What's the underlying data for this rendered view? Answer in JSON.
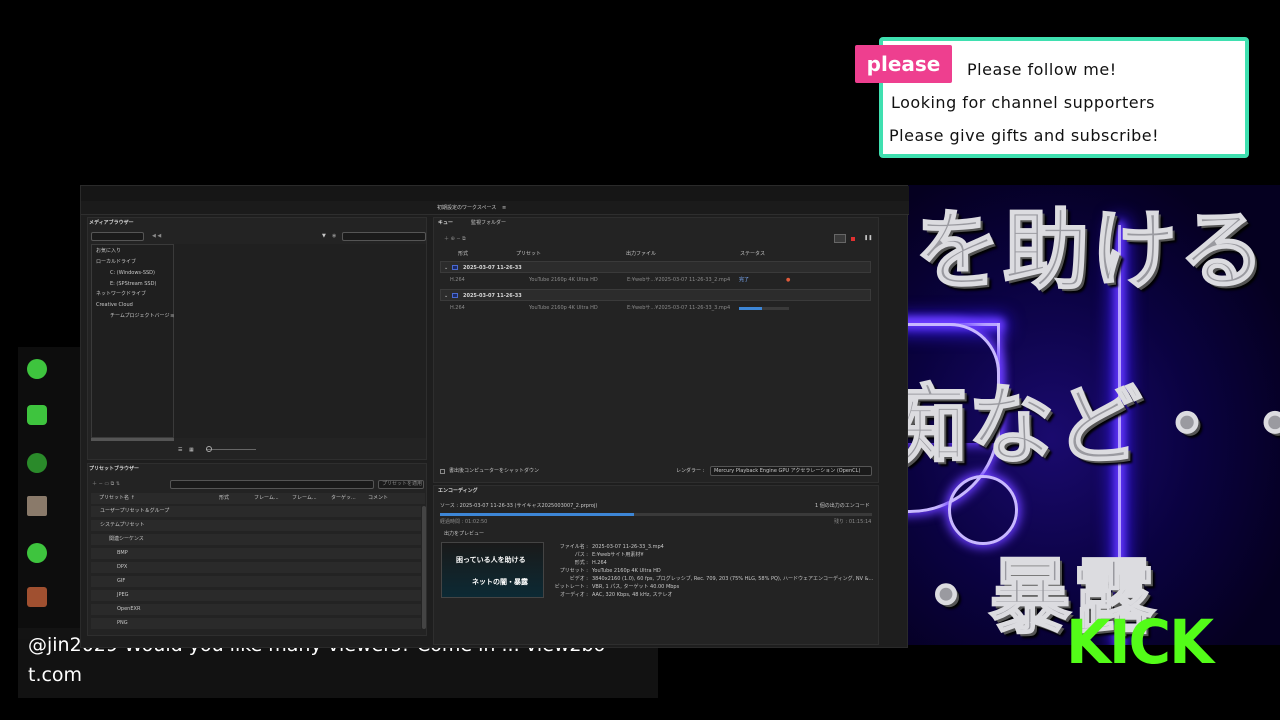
{
  "overlay": {
    "please_badge": "please",
    "follow_lines": [
      "Please follow me!",
      "Looking for channel supporters",
      "Please give gifts and subscribe!"
    ],
    "big_text": [
      "を助ける",
      "痴など・・・",
      "・暴露"
    ],
    "kick_logo": "KICK",
    "chat_message": "@jin2029 Would you like many viewers? Come in ... view2bo",
    "chat_message_2": "t.com",
    "colors": {
      "follow_border": "#3fe0b0",
      "badge": "#ee3f8f",
      "kick": "#53fc18"
    }
  },
  "app": {
    "workspace_tab": "初期設定のワークスペース",
    "media_browser": {
      "title": "メディアブラウザー",
      "tree": [
        "お気に入り",
        "ローカルドライブ",
        "C: (Windows-SSD)",
        "E: (SPStream SSD)",
        "ネットワークドライブ",
        "Creative Cloud",
        "チームプロジェクトバージョ"
      ]
    },
    "queue": {
      "tabs": [
        "キュー",
        "監視フォルダー"
      ],
      "columns": [
        "形式",
        "プリセット",
        "出力ファイル",
        "ステータス"
      ],
      "groups": [
        {
          "name": "2025-03-07 11-26-33",
          "format": "H.264",
          "preset": "YouTube 2160p 4K Ultra HD",
          "output": "E:¥webサ...¥2025-03-07 11-26-33_2.mp4",
          "status": "完了",
          "progress": 1.0
        },
        {
          "name": "2025-03-07 11-26-33",
          "format": "H.264",
          "preset": "YouTube 2160p 4K Ultra HD",
          "output": "E:¥webサ...¥2025-03-07 11-26-33_3.mp4",
          "status": "",
          "progress": 0.45
        }
      ],
      "auto_shutdown": "書出後コンピューターをシャットダウン",
      "renderer_label": "レンダラー :",
      "renderer_value": "Mercury Playback Engine GPU アクセラレーション (OpenCL)"
    },
    "preset_browser": {
      "title": "プリセットブラウザー",
      "apply_button": "プリセットを適用",
      "columns": [
        "プリセット名 ↑",
        "形式",
        "フレーム...",
        "フレーム...",
        "ターゲッ...",
        "コメント"
      ],
      "rows": [
        "ユーザープリセット＆グループ",
        "システムプリセット",
        "関連シーケンス",
        "BMP",
        "DPX",
        "GIF",
        "JPEG",
        "OpenEXR",
        "PNG"
      ]
    },
    "encoding": {
      "title": "エンコーディング",
      "source": "ソース : 2025-03-07 11-26-33 (サイキャス2025003007_2.prproj)",
      "count": "1 個の出力のエンコード",
      "elapsed": "経過時間 : 01:02:50",
      "remaining": "残り : 01:15:14",
      "progress": 0.45,
      "preview_label": "出力をプレビュー",
      "details": [
        {
          "label": "ファイル名 :",
          "value": "2025-03-07 11-26-33_3.mp4"
        },
        {
          "label": "パス :",
          "value": "E:¥webサイト用素材¥"
        },
        {
          "label": "形式 :",
          "value": "H.264"
        },
        {
          "label": "プリセット :",
          "value": "YouTube 2160p 4K Ultra HD"
        },
        {
          "label": "ビデオ :",
          "value": "3840x2160 (1.0), 60 fps, プログレッシブ, Rec. 709, 203 (75% HLG, 58% PQ), ハードウェアエンコーディング, NV &..."
        },
        {
          "label": "ビットレート :",
          "value": "VBR, 1 パス, ターゲット 40.00 Mbps"
        },
        {
          "label": "オーディオ :",
          "value": "AAC, 320 Kbps, 48 kHz, ステレオ"
        }
      ],
      "thumb_caption": [
        "困っている人を助ける",
        "ネットの闇・暴露"
      ]
    }
  }
}
